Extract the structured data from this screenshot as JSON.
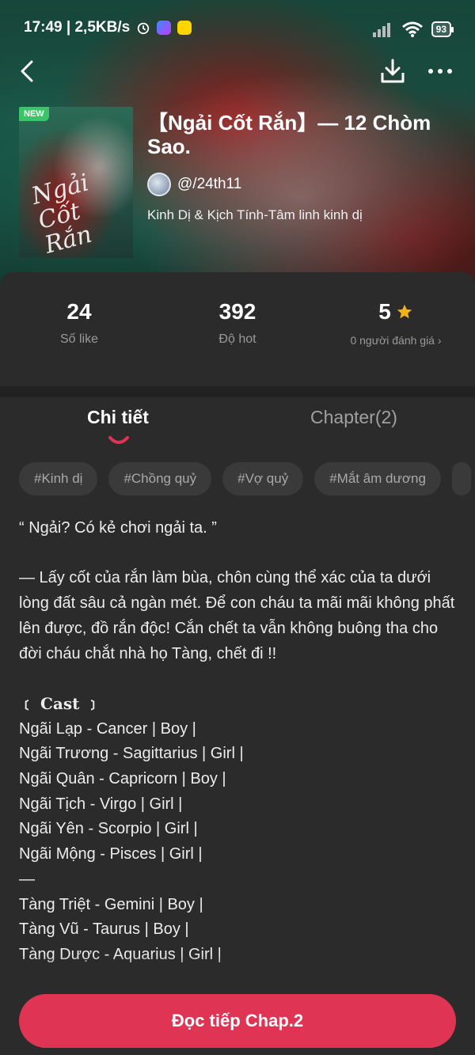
{
  "status_bar": {
    "time_speed": "17:49 | 2,5KB/s",
    "battery": "93"
  },
  "book": {
    "badge": "NEW",
    "cover_title": "Ngải\nCốt\nRắn",
    "title": "【Ngải Cốt Rắn】— 12 Chòm Sao.",
    "author": "@/24th11",
    "genre": "Kinh Dị & Kịch Tính-Tâm linh kinh dị"
  },
  "stats": [
    {
      "value": "24",
      "label": "Số like"
    },
    {
      "value": "392",
      "label": "Độ hot"
    },
    {
      "value": "5",
      "label": "0 người đánh giá ›"
    }
  ],
  "tabs": {
    "details": "Chi tiết",
    "chapters": "Chapter(2)"
  },
  "tags": [
    "#Kinh dị",
    "#Chồng quỷ",
    "#Vợ quỷ",
    "#Mắt âm dương"
  ],
  "description": [
    "“ Ngải? Có kẻ chơi ngải ta. ”",
    "",
    "— Lấy cốt của rắn làm bùa, chôn cùng thể xác của ta dưới lòng đất sâu cả ngàn mét. Để con cháu ta mãi mãi không phất lên được, đồ rắn độc! Cắn chết ta vẫn không buông tha cho đời cháu chắt nhà họ Tàng, chết đi !!",
    "",
    "﹝ Cast ﹞",
    "Ngãi Lạp - Cancer | Boy |",
    "Ngãi Trương - Sagittarius | Girl |",
    "Ngãi Quân - Capricorn | Boy |",
    "Ngãi Tịch - Virgo | Girl |",
    "Ngãi Yên - Scorpio | Girl |",
    "Ngãi Mộng - Pisces | Girl |",
    "—",
    "Tàng Triệt - Gemini | Boy |",
    "Tàng Vũ - Taurus | Boy |",
    "Tàng Dược - Aquarius | Girl |"
  ],
  "cta": "Đọc tiếp Chap.2",
  "colors": {
    "accent": "#e03454",
    "background": "#2b2b2b",
    "star": "#f6b21b",
    "new_badge": "#3cc46b"
  }
}
